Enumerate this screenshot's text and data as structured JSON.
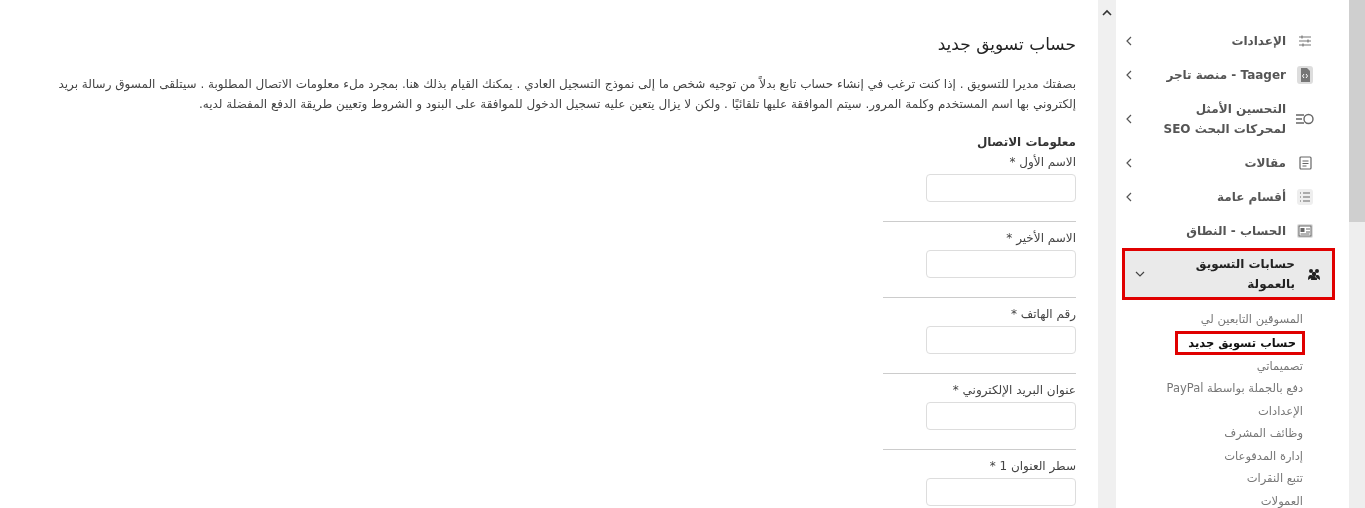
{
  "page": {
    "title": "حساب تسويق جديد",
    "description": "بصفتك مديرا للتسويق . إذا كنت ترغب في إنشاء حساب تابع بدلاً من توجيه شخص ما إلى نموذج التسجيل العادي . يمكنك القيام بذلك هنا. بمجرد ملء معلومات الاتصال المطلوبة . سيتلقى المسوق رسالة بريد إلكتروني بها اسم المستخدم وكلمة المرور. سيتم الموافقة عليها تلقائيًا . ولكن لا يزال يتعين عليه تسجيل الدخول للموافقة على البنود و الشروط وتعيين طريقة الدفع المفضلة لديه.",
    "section": "معلومات الاتصال",
    "fields": [
      {
        "label": "الاسم الأول",
        "mark": "*"
      },
      {
        "label": "الاسم الأخير",
        "mark": "*"
      },
      {
        "label": "رقم الهاتف",
        "mark": "*"
      },
      {
        "label": "عنوان البريد الإلكتروني",
        "mark": "*"
      },
      {
        "label": "سطر العنوان 1",
        "mark": "*"
      }
    ]
  },
  "sidebar": {
    "items": [
      {
        "label": "الإعدادات",
        "expanded": false,
        "selected": false
      },
      {
        "label": "Taager - منصة تاجر",
        "expanded": false,
        "selected": false
      },
      {
        "label": "التحسين الأمثل لمحركات البحث SEO",
        "expanded": false,
        "selected": false
      },
      {
        "label": "مقالات",
        "expanded": false,
        "selected": false
      },
      {
        "label": "أقسام عامة",
        "expanded": false,
        "selected": false
      },
      {
        "label": "الحساب - النطاق",
        "selected": false
      },
      {
        "label": "حسابات التسويق بالعمولة",
        "expanded": true,
        "selected": true,
        "children": [
          {
            "label": "المسوقين التابعين لي",
            "selected": false
          },
          {
            "label": "حساب تسويق جديد",
            "selected": true
          },
          {
            "label": "تصميماتي",
            "selected": false
          },
          {
            "label": "دفع بالجملة بواسطة PayPal",
            "selected": false
          },
          {
            "label": "الإعدادات",
            "selected": false
          },
          {
            "label": "وظائف المشرف",
            "selected": false
          },
          {
            "label": "إدارة المدفوعات",
            "selected": false
          },
          {
            "label": "تتبع النقرات",
            "selected": false
          },
          {
            "label": "العمولات",
            "selected": false
          }
        ]
      }
    ]
  }
}
